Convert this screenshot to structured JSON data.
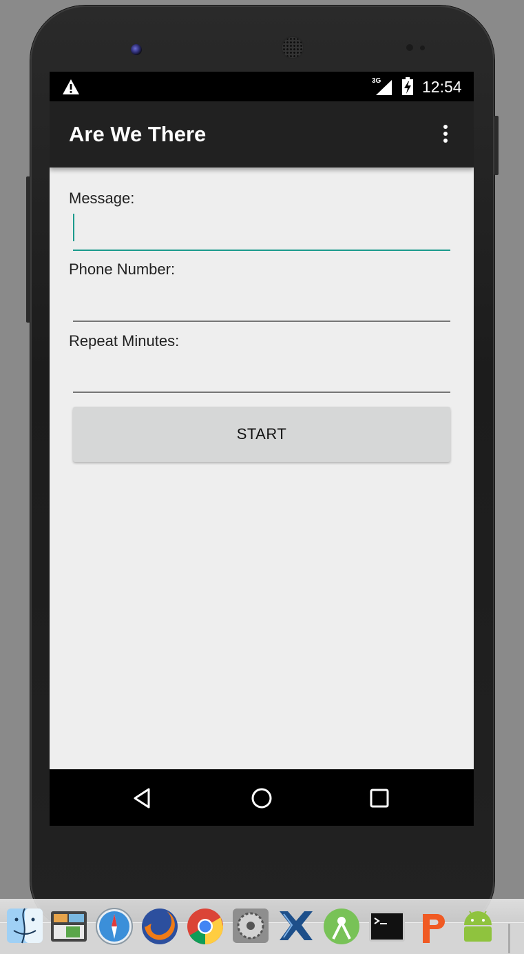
{
  "status_bar": {
    "network": "3G",
    "time": "12:54",
    "warning_icon": "warning-icon",
    "signal_icon": "signal-icon",
    "battery_icon": "battery-charging-icon"
  },
  "app_bar": {
    "title": "Are We There",
    "menu_icon": "more-vert-icon"
  },
  "form": {
    "message": {
      "label": "Message:",
      "value": ""
    },
    "phone": {
      "label": "Phone Number:",
      "value": ""
    },
    "repeat": {
      "label": "Repeat Minutes:",
      "value": ""
    },
    "start_label": "START"
  },
  "nav_bar": {
    "back_icon": "back-triangle-icon",
    "home_icon": "home-circle-icon",
    "recents_icon": "recents-square-icon"
  },
  "dock": {
    "apps": [
      "finder-icon",
      "preview-icon",
      "safari-icon",
      "firefox-icon",
      "chrome-icon",
      "system-preferences-icon",
      "xcode-icon",
      "android-studio-icon",
      "terminal-icon",
      "powerpoint-icon",
      "android-icon"
    ]
  },
  "colors": {
    "accent": "#1a9a8c",
    "app_bar": "#212121",
    "screen_bg": "#eeeeee",
    "button_bg": "#d6d7d7"
  }
}
